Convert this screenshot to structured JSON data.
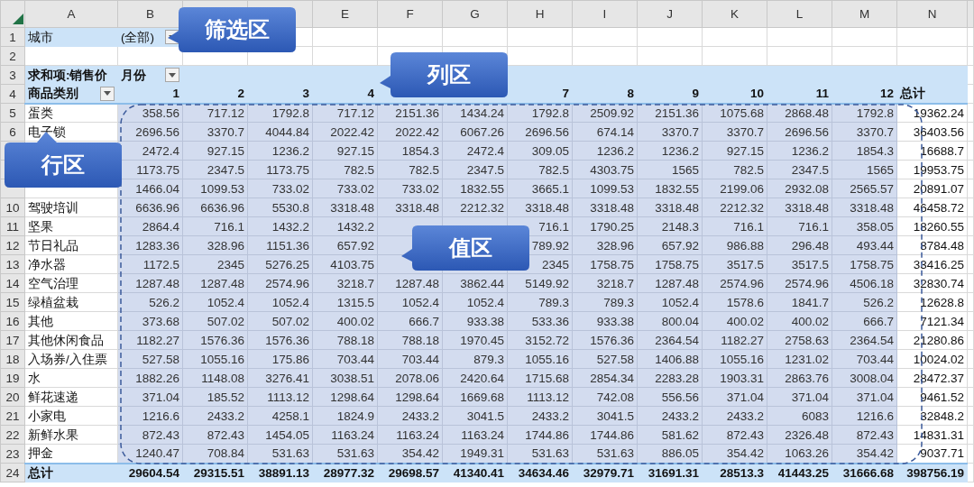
{
  "columns": [
    "A",
    "B"
  ],
  "columns_after_gap": [
    "E",
    "F",
    "G",
    "H",
    "I",
    "J",
    "K",
    "L",
    "M",
    "N"
  ],
  "filter": {
    "number": "1",
    "field": "城市",
    "value": "(全部)"
  },
  "blank_row": {
    "number": "2"
  },
  "pivot_header": {
    "numbers": [
      "3",
      "4"
    ],
    "value_field": "求和项:销售价",
    "column_field": "月份",
    "row_field": "商品类别",
    "months": [
      "1",
      "2",
      "3",
      "4"
    ],
    "months_after_gap": [
      "7",
      "8",
      "9",
      "10",
      "11",
      "12"
    ],
    "total_label": "总计"
  },
  "rows": [
    {
      "number": "5",
      "label": "蛋类",
      "values": [
        "358.56",
        "717.12",
        "1792.8",
        "717.12",
        "2151.36",
        "1434.24",
        "1792.8",
        "2509.92",
        "2151.36",
        "1075.68",
        "2868.48",
        "1792.8"
      ],
      "total": "19362.24"
    },
    {
      "number": "6",
      "label": "电子锁",
      "values": [
        "2696.56",
        "3370.7",
        "4044.84",
        "2022.42",
        "2022.42",
        "6067.26",
        "2696.56",
        "674.14",
        "3370.7",
        "3370.7",
        "2696.56",
        "3370.7"
      ],
      "total": "36403.56"
    },
    {
      "values": [
        "2472.4",
        "927.15",
        "1236.2",
        "927.15",
        "1854.3",
        "2472.4",
        "309.05",
        "1236.2",
        "1236.2",
        "927.15",
        "1236.2",
        "1854.3"
      ],
      "total": "16688.7"
    },
    {
      "values": [
        "1173.75",
        "2347.5",
        "1173.75",
        "782.5",
        "782.5",
        "2347.5",
        "782.5",
        "4303.75",
        "1565",
        "782.5",
        "2347.5",
        "1565"
      ],
      "total": "19953.75"
    },
    {
      "values": [
        "1466.04",
        "1099.53",
        "733.02",
        "733.02",
        "733.02",
        "1832.55",
        "3665.1",
        "1099.53",
        "1832.55",
        "2199.06",
        "2932.08",
        "2565.57"
      ],
      "total": "20891.07"
    },
    {
      "number": "10",
      "label": "驾驶培训",
      "values": [
        "6636.96",
        "6636.96",
        "5530.8",
        "3318.48",
        "3318.48",
        "2212.32",
        "3318.48",
        "3318.48",
        "3318.48",
        "2212.32",
        "3318.48",
        "3318.48"
      ],
      "total": "46458.72"
    },
    {
      "number": "11",
      "label": "坚果",
      "values": [
        "2864.4",
        "716.1",
        "1432.2",
        "1432.2"
      ],
      "values_after_gap": [
        "716.1",
        "1790.25",
        "2148.3",
        "716.1",
        "716.1",
        "358.05"
      ],
      "total": "18260.55"
    },
    {
      "number": "12",
      "label": "节日礼品",
      "values": [
        "1283.36",
        "328.96",
        "1151.36",
        "657.92"
      ],
      "values_after_gap": [
        "789.92",
        "328.96",
        "657.92",
        "986.88",
        "296.48",
        "493.44"
      ],
      "total": "8784.48"
    },
    {
      "number": "13",
      "label": "净水器",
      "values": [
        "1172.5",
        "2345",
        "5276.25",
        "4103.75"
      ],
      "values_after_gap": [
        "2345",
        "1758.75",
        "1758.75",
        "3517.5",
        "3517.5",
        "1758.75"
      ],
      "total": "33416.25"
    },
    {
      "number": "14",
      "label": "空气治理",
      "values": [
        "1287.48",
        "1287.48",
        "2574.96",
        "3218.7",
        "1287.48",
        "3862.44",
        "5149.92",
        "3218.7",
        "1287.48",
        "2574.96",
        "2574.96",
        "4506.18"
      ],
      "total": "32830.74"
    },
    {
      "number": "15",
      "label": "绿植盆栽",
      "values": [
        "526.2",
        "1052.4",
        "1052.4",
        "1315.5",
        "1052.4",
        "1052.4",
        "789.3",
        "789.3",
        "1052.4",
        "1578.6",
        "1841.7",
        "526.2"
      ],
      "total": "12628.8"
    },
    {
      "number": "16",
      "label": "其他",
      "values": [
        "373.68",
        "507.02",
        "507.02",
        "400.02",
        "666.7",
        "933.38",
        "533.36",
        "933.38",
        "800.04",
        "400.02",
        "400.02",
        "666.7"
      ],
      "total": "7121.34"
    },
    {
      "number": "17",
      "label": "其他休闲食品",
      "values": [
        "1182.27",
        "1576.36",
        "1576.36",
        "788.18",
        "788.18",
        "1970.45",
        "3152.72",
        "1576.36",
        "2364.54",
        "1182.27",
        "2758.63",
        "2364.54"
      ],
      "total": "21280.86"
    },
    {
      "number": "18",
      "label": "入场券/入住票",
      "values": [
        "527.58",
        "1055.16",
        "175.86",
        "703.44",
        "703.44",
        "879.3",
        "1055.16",
        "527.58",
        "1406.88",
        "1055.16",
        "1231.02",
        "703.44"
      ],
      "total": "10024.02"
    },
    {
      "number": "19",
      "label": "水",
      "values": [
        "1882.26",
        "1148.08",
        "3276.41",
        "3038.51",
        "2078.06",
        "2420.64",
        "1715.68",
        "2854.34",
        "2283.28",
        "1903.31",
        "2863.76",
        "3008.04"
      ],
      "total": "28472.37"
    },
    {
      "number": "20",
      "label": "鲜花速递",
      "values": [
        "371.04",
        "185.52",
        "1113.12",
        "1298.64",
        "1298.64",
        "1669.68",
        "1113.12",
        "742.08",
        "556.56",
        "371.04",
        "371.04",
        "371.04"
      ],
      "total": "9461.52"
    },
    {
      "number": "21",
      "label": "小家电",
      "values": [
        "1216.6",
        "2433.2",
        "4258.1",
        "1824.9",
        "2433.2",
        "3041.5",
        "2433.2",
        "3041.5",
        "2433.2",
        "2433.2",
        "6083",
        "1216.6"
      ],
      "total": "32848.2"
    },
    {
      "number": "22",
      "label": "新鲜水果",
      "values": [
        "872.43",
        "872.43",
        "1454.05",
        "1163.24",
        "1163.24",
        "1163.24",
        "1744.86",
        "1744.86",
        "581.62",
        "872.43",
        "2326.48",
        "872.43"
      ],
      "total": "14831.31"
    },
    {
      "number": "23",
      "label": "押金",
      "values": [
        "1240.47",
        "708.84",
        "531.63",
        "531.63",
        "354.42",
        "1949.31",
        "531.63",
        "531.63",
        "886.05",
        "354.42",
        "1063.26",
        "354.42"
      ],
      "total": "9037.71"
    }
  ],
  "grand_total": {
    "number": "24",
    "label": "总计",
    "values": [
      "29604.54",
      "29315.51",
      "38891.13",
      "28977.32",
      "29698.57",
      "41340.41",
      "34634.46",
      "32979.71",
      "31691.31",
      "28513.3",
      "41443.25",
      "31666.68"
    ],
    "total": "398756.19"
  },
  "callouts": [
    {
      "text": "筛选区",
      "kind": "left"
    },
    {
      "text": "列区",
      "kind": "left"
    },
    {
      "text": "行区",
      "kind": "up"
    },
    {
      "text": "值区",
      "kind": "left"
    }
  ]
}
